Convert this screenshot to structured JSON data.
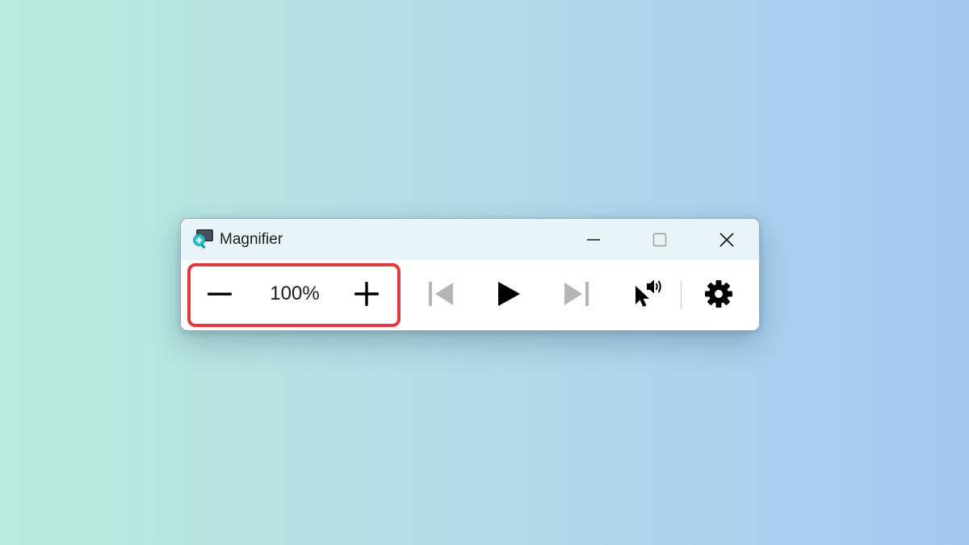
{
  "window": {
    "title": "Magnifier",
    "app_icon": "magnifier-app-icon"
  },
  "caption_buttons": {
    "minimize_icon": "minimize-icon",
    "maximize_icon": "maximize-icon",
    "close_icon": "close-icon"
  },
  "toolbar": {
    "zoom_level": "100%",
    "zoom_out_icon": "minus-icon",
    "zoom_in_icon": "plus-icon",
    "previous_icon": "skip-previous-icon",
    "play_icon": "play-icon",
    "next_icon": "skip-next-icon",
    "read_from_here_icon": "pointer-speaker-icon",
    "settings_icon": "gear-icon"
  },
  "colors": {
    "highlight_border": "#e0393e",
    "titlebar_bg": "#e9f4f8",
    "disabled_icon": "#b5b5b5",
    "enabled_icon": "#000000"
  }
}
